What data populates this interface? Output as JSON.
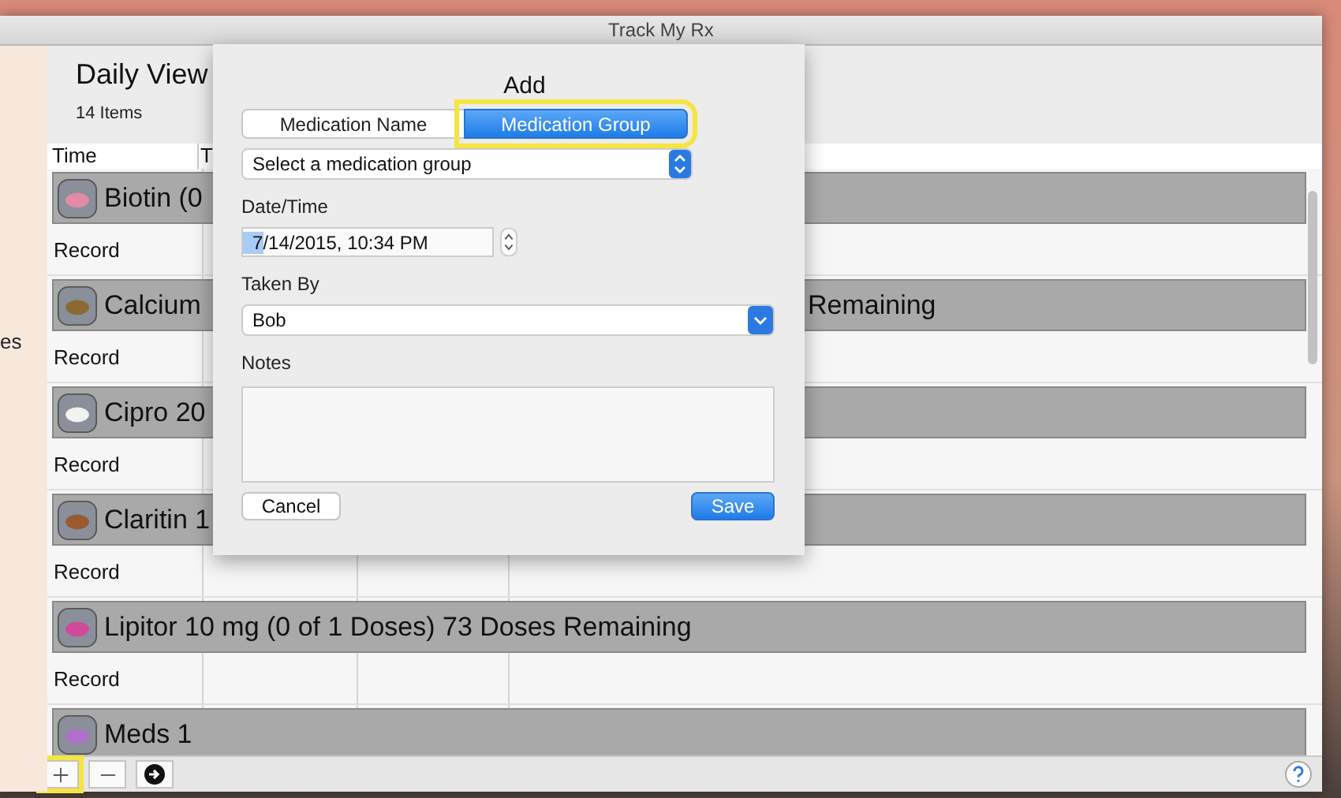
{
  "window": {
    "title": "Track My Rx"
  },
  "sidebar": {
    "item_fragment": "es"
  },
  "header": {
    "title": "Daily View",
    "count": "14 Items"
  },
  "table": {
    "columns": [
      "Time",
      "T"
    ],
    "groups": [
      {
        "label": "Biotin (0",
        "color": "#e38aa6",
        "record": "Record"
      },
      {
        "label": "Calcium",
        "trailing": "Remaining",
        "color": "#8a6a2e",
        "record": "Record"
      },
      {
        "label": "Cipro 20",
        "color": "#f2f2f2",
        "record": "Record"
      },
      {
        "label": "Claritin 1",
        "color": "#9a5a30",
        "record": "Record"
      },
      {
        "label": "Lipitor 10 mg (0 of 1 Doses) 73 Doses Remaining",
        "color": "#d04a9a",
        "record": "Record"
      },
      {
        "label": "Meds 1",
        "color": "#b070c8"
      }
    ]
  },
  "dialog": {
    "title": "Add",
    "segments": [
      {
        "label": "Medication Name",
        "selected": false,
        "highlighted": false
      },
      {
        "label": "Medication Group",
        "selected": true,
        "highlighted": true
      }
    ],
    "group_select": {
      "placeholder": "Select a medication group"
    },
    "date_label": "Date/Time",
    "date_value": "7/14/2015, 10:34 PM",
    "taken_label": "Taken By",
    "taken_value": "Bob",
    "notes_label": "Notes",
    "buttons": [
      {
        "label": "Cancel",
        "kind": "cancel"
      },
      {
        "label": "Save",
        "kind": "default"
      }
    ]
  },
  "bottom_bar": {
    "buttons": [
      {
        "kind": "plus",
        "highlighted": true
      },
      {
        "kind": "minus",
        "highlighted": false
      },
      {
        "kind": "arrow",
        "highlighted": false
      }
    ]
  }
}
